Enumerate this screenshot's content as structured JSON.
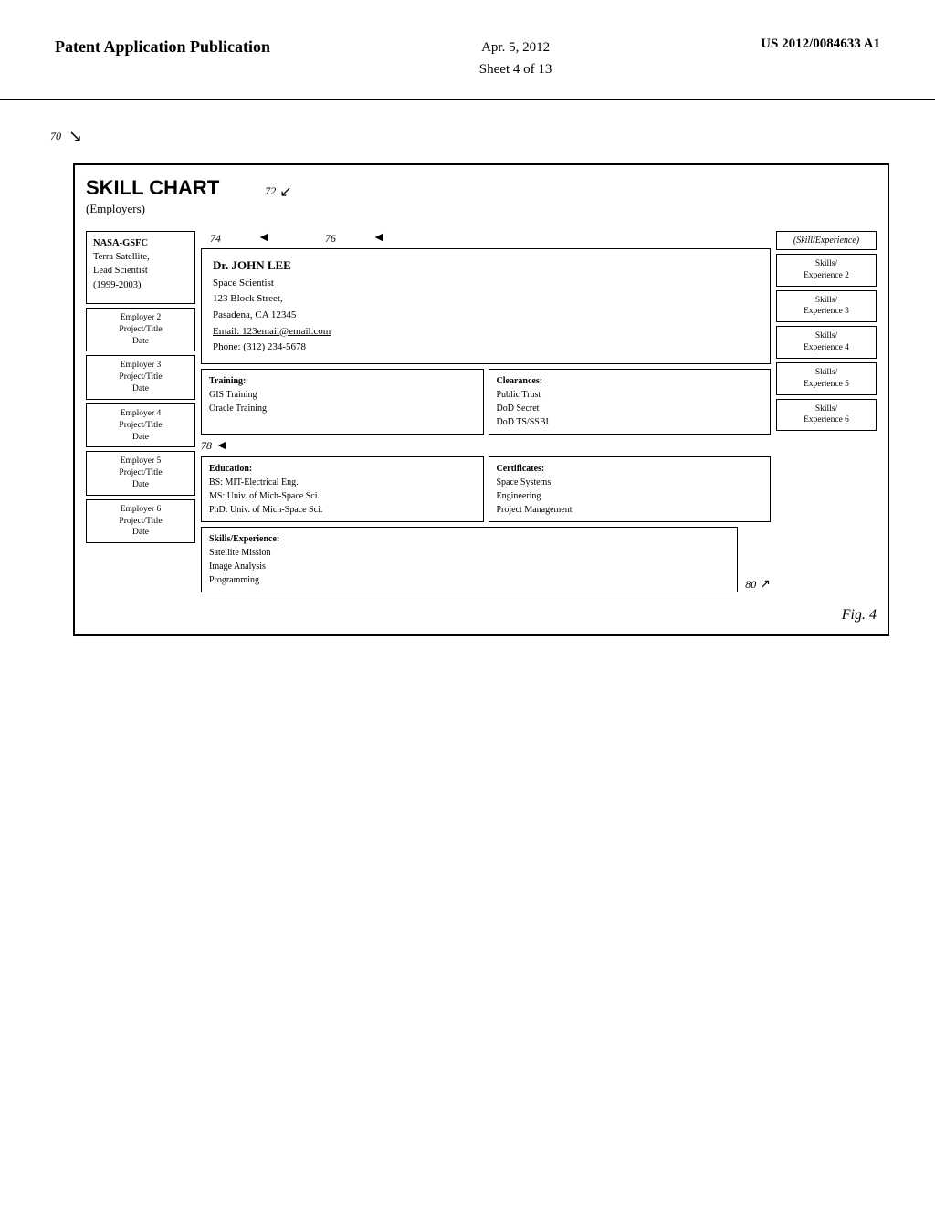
{
  "header": {
    "left_title": "Patent Application Publication",
    "center_date": "Apr. 5, 2012",
    "center_sheet": "Sheet 4 of 13",
    "right_patent": "US 2012/0084633 A1"
  },
  "diagram": {
    "ref_70": "70",
    "ref_72": "72",
    "ref_74": "74",
    "ref_76": "76",
    "ref_78": "78",
    "ref_80": "80",
    "chart_title": "SKILL CHART",
    "employers_label": "(Employers)",
    "employer_main": {
      "company": "NASA-GSFC",
      "detail1": "Terra Satellite,",
      "detail2": "Lead Scientist",
      "detail3": "(1999-2003)"
    },
    "employer2": {
      "line1": "Employer 2",
      "line2": "Project/Title",
      "line3": "Date"
    },
    "employer3": {
      "line1": "Employer 3",
      "line2": "Project/Title",
      "line3": "Date"
    },
    "employer4": {
      "line1": "Employer 4",
      "line2": "Project/Title",
      "line3": "Date"
    },
    "employer5": {
      "line1": "Employer 5",
      "line2": "Project/Title",
      "line3": "Date"
    },
    "employer6": {
      "line1": "Employer 6",
      "line2": "Project/Title",
      "line3": "Date"
    },
    "person": {
      "name": "Dr. JOHN LEE",
      "title": "Space Scientist",
      "address": "123 Block Street,",
      "city": "Pasadena, CA 12345",
      "email": "Email: 123email@email.com",
      "phone": "Phone: (312) 234-5678"
    },
    "education": {
      "label": "Education:",
      "bs": "BS: MIT-Electrical Eng.",
      "ms": "MS: Univ. of Mich-Space Sci.",
      "phd": "PhD: Univ. of Mich-Space Sci."
    },
    "certificates": {
      "label": "Certificates:",
      "c1": "Space Systems",
      "c2": "Engineering",
      "c3": "Project Management"
    },
    "training": {
      "label": "Training:",
      "t1": "GIS Training",
      "t2": "Oracle Training"
    },
    "clearances": {
      "label": "Clearances:",
      "c1": "Public Trust",
      "c2": "DoD Secret",
      "c3": "DoD TS/SSBI"
    },
    "skills_exp_label": "(Skill/Experience)",
    "skills_bottom_label": "Skills/Experience:",
    "skills_bottom": {
      "s1": "Satellite Mission",
      "s2": "Image Analysis",
      "s3": "Programming"
    },
    "skill_exp2": {
      "line1": "Skills/",
      "line2": "Experience 2"
    },
    "skill_exp3": {
      "line1": "Skills/",
      "line2": "Experience 3"
    },
    "skill_exp4": {
      "line1": "Skills/",
      "line2": "Experience 4"
    },
    "skill_exp5": {
      "line1": "Skills/",
      "line2": "Experience 5"
    },
    "skill_exp6": {
      "line1": "Skills/",
      "line2": "Experience 6"
    },
    "fig_label": "Fig. 4"
  }
}
